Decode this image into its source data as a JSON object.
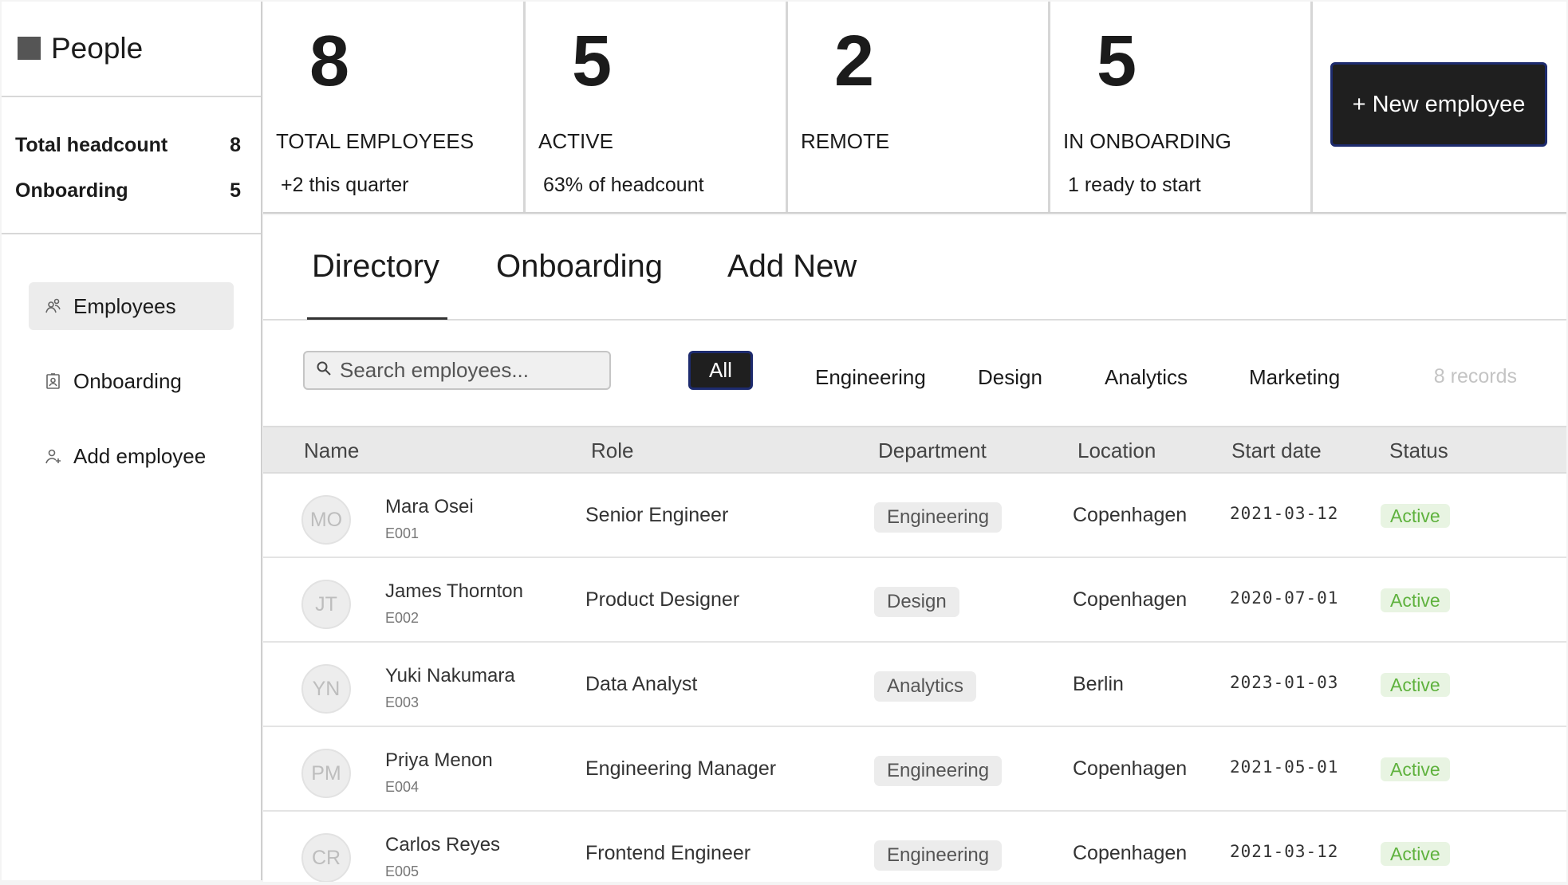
{
  "app": {
    "title": "People"
  },
  "sidebar": {
    "stats": [
      {
        "label": "Total headcount",
        "value": "8"
      },
      {
        "label": "Onboarding",
        "value": "5"
      }
    ],
    "nav": [
      {
        "label": "Employees",
        "icon": "users-icon",
        "active": true
      },
      {
        "label": "Onboarding",
        "icon": "clipboard-icon",
        "active": false
      },
      {
        "label": "Add employee",
        "icon": "add-user-icon",
        "active": false
      }
    ]
  },
  "kpis": [
    {
      "value": "8",
      "label": "TOTAL EMPLOYEES",
      "sub": "+2 this quarter"
    },
    {
      "value": "5",
      "label": "ACTIVE",
      "sub": "63% of headcount"
    },
    {
      "value": "2",
      "label": "REMOTE",
      "sub": ""
    },
    {
      "value": "5",
      "label": "IN ONBOARDING",
      "sub": "1 ready to start"
    }
  ],
  "actions": {
    "new_employee": "+ New employee"
  },
  "tabs": [
    "Directory",
    "Onboarding",
    "Add New"
  ],
  "filters": {
    "search_placeholder": "Search employees...",
    "chips": [
      "All",
      "Engineering",
      "Design",
      "Analytics",
      "Marketing"
    ],
    "records": "8 records"
  },
  "table": {
    "headers": [
      "Name",
      "Role",
      "Department",
      "Location",
      "Start date",
      "Status"
    ],
    "rows": [
      {
        "initials": "MO",
        "name": "Mara Osei",
        "id": "E001",
        "role": "Senior Engineer",
        "department": "Engineering",
        "location": "Copenhagen",
        "start": "2021-03-12",
        "status": "Active"
      },
      {
        "initials": "JT",
        "name": "James Thornton",
        "id": "E002",
        "role": "Product Designer",
        "department": "Design",
        "location": "Copenhagen",
        "start": "2020-07-01",
        "status": "Active"
      },
      {
        "initials": "YN",
        "name": "Yuki Nakumara",
        "id": "E003",
        "role": "Data Analyst",
        "department": "Analytics",
        "location": "Berlin",
        "start": "2023-01-03",
        "status": "Active"
      },
      {
        "initials": "PM",
        "name": "Priya Menon",
        "id": "E004",
        "role": "Engineering Manager",
        "department": "Engineering",
        "location": "Copenhagen",
        "start": "2021-05-01",
        "status": "Active"
      },
      {
        "initials": "CR",
        "name": "Carlos Reyes",
        "id": "E005",
        "role": "Frontend Engineer",
        "department": "Engineering",
        "location": "Copenhagen",
        "start": "2021-03-12",
        "status": "Active"
      }
    ]
  },
  "colors": {
    "accent_dark": "#1f1f1f",
    "status_active": "#5fb23e",
    "status_active_bg": "#e8f4e2"
  }
}
